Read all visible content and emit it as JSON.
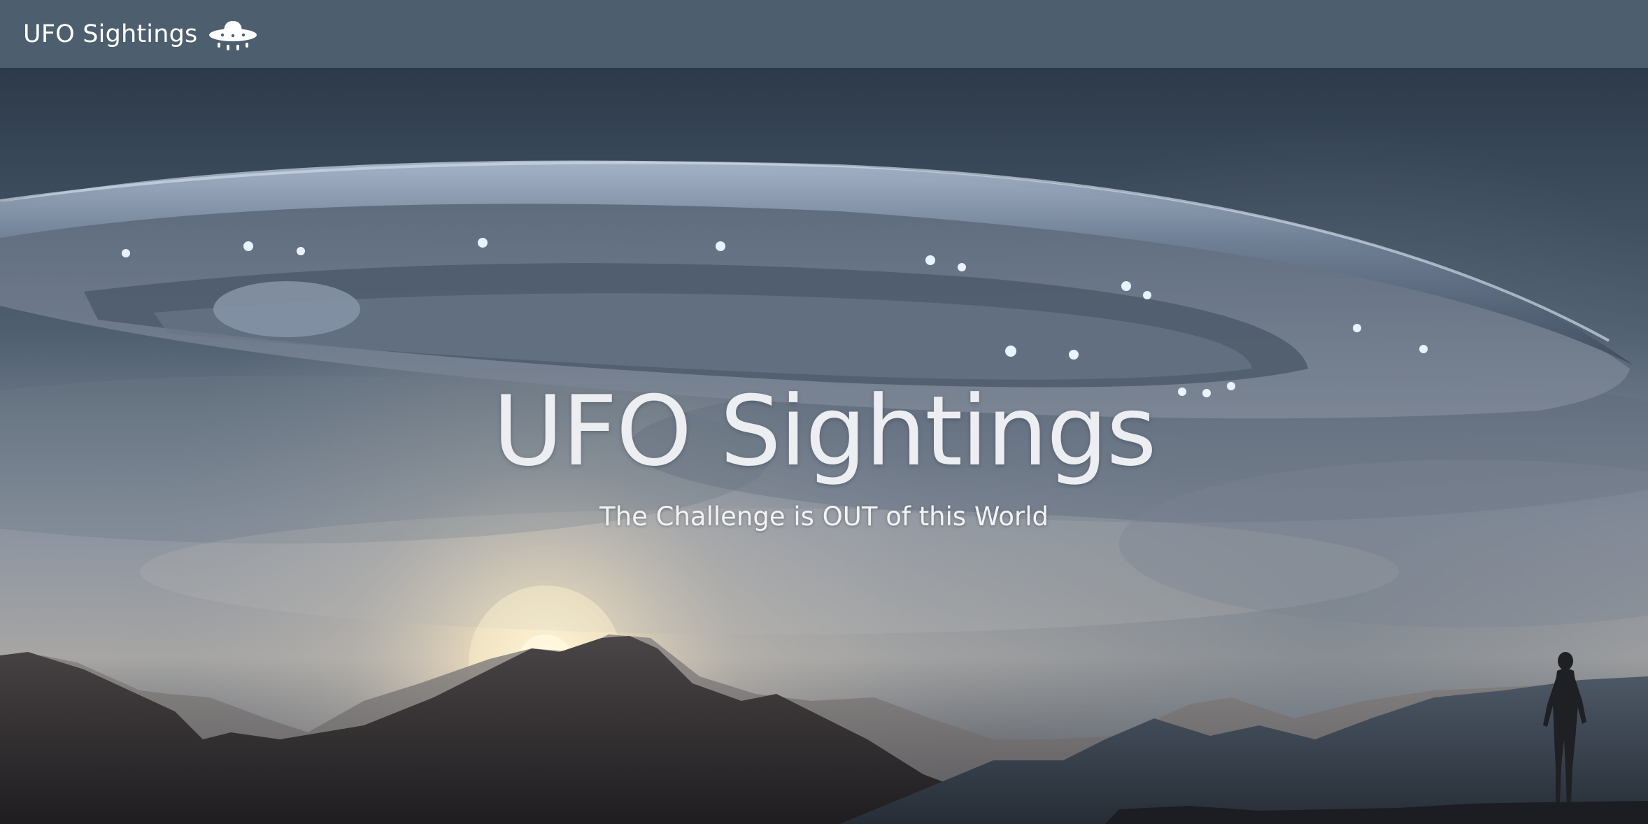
{
  "navbar": {
    "brand_label": "UFO Sightings",
    "brand_icon": "ufo-icon",
    "background_color": "#4d5f6e"
  },
  "hero": {
    "title": "UFO Sightings",
    "subtitle": "The Challenge is OUT of this World",
    "background_image": "ufo-over-mountains-photo"
  }
}
